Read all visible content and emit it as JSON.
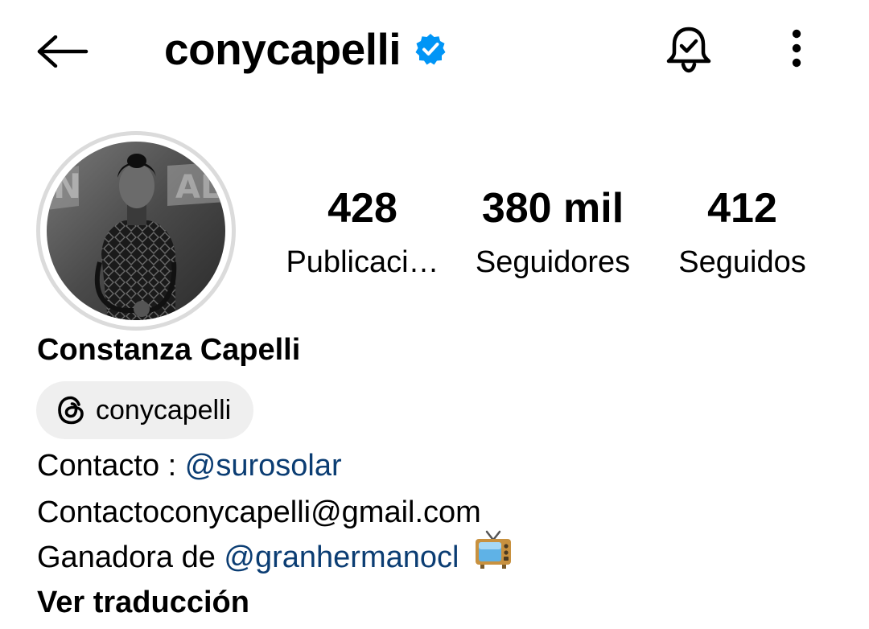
{
  "header": {
    "username": "conycapelli",
    "back_icon": "arrow-left-icon",
    "verified_icon": "verified-badge-icon",
    "notification_icon": "bell-check-icon",
    "more_icon": "more-vertical-icon",
    "verified_color": "#0095f6"
  },
  "profile": {
    "avatar_icon": "profile-photo",
    "full_name": "Constanza Capelli",
    "stats": [
      {
        "value": "428",
        "label": "Publicaci…"
      },
      {
        "value": "380 mil",
        "label": "Seguidores"
      },
      {
        "value": "412",
        "label": "Seguidos"
      }
    ],
    "threads": {
      "icon": "threads-icon",
      "label": "conycapelli"
    },
    "bio": {
      "line1_text": "Contacto : ",
      "line1_mention": "@surosolar",
      "line2_text": "Contactoconycapelli@gmail.com",
      "line3_text": "Ganadora de ",
      "line3_mention": "@granhermanocl",
      "line3_emoji_icon": "tv-icon"
    },
    "see_translation": "Ver traducción",
    "mention_color": "#0b3d73",
    "chip_color": "#efefef"
  }
}
